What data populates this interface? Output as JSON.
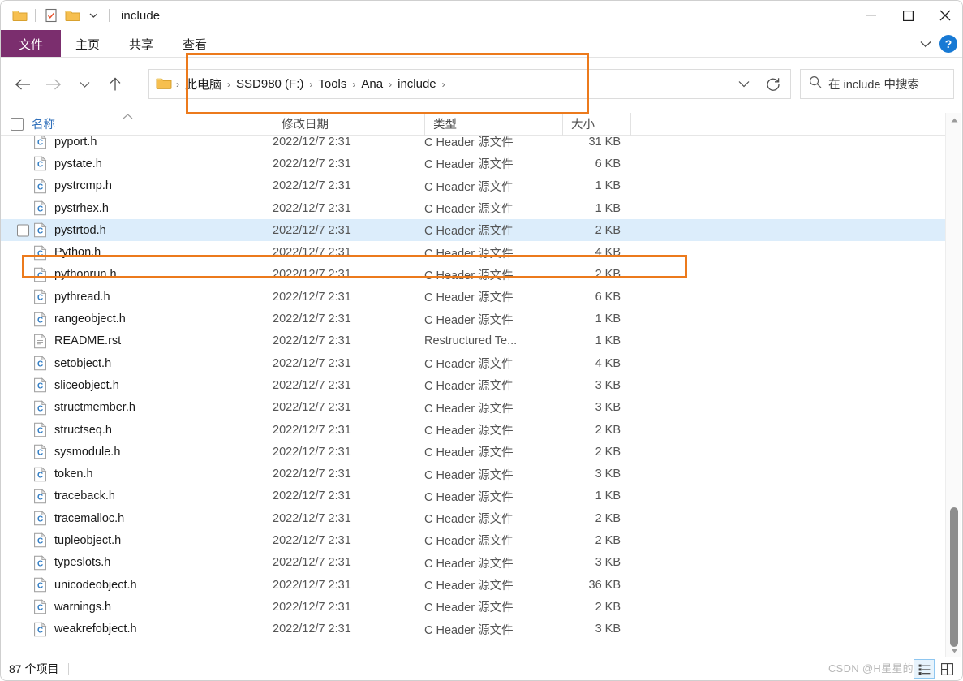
{
  "window": {
    "title": "include",
    "quick_access": [
      "folder-icon",
      "properties-icon",
      "new-folder-icon",
      "customize-chevron-icon"
    ],
    "controls": {
      "minimize": "–",
      "maximize": "□",
      "close": "✕"
    }
  },
  "ribbon": {
    "tabs": [
      {
        "label": "文件",
        "active": true,
        "accent": "#7b2e6e"
      },
      {
        "label": "主页",
        "active": false
      },
      {
        "label": "共享",
        "active": false
      },
      {
        "label": "查看",
        "active": false
      }
    ],
    "collapse_icon": "chevron-down-icon",
    "help_label": "?"
  },
  "navigation": {
    "back": "←",
    "forward": "→",
    "recent": "∨",
    "up": "↑"
  },
  "address": {
    "breadcrumbs": [
      "此电脑",
      "SSD980 (F:)",
      "Tools",
      "Ana",
      "include"
    ],
    "separator": "›",
    "trailing_separator": "›",
    "dropdown_icon": "chevron-down-icon",
    "refresh_icon": "refresh-icon"
  },
  "search": {
    "placeholder": "在 include 中搜索",
    "icon": "search-icon"
  },
  "columns": [
    {
      "key": "name",
      "label": "名称",
      "sorted": true,
      "sort_dir": "asc"
    },
    {
      "key": "date",
      "label": "修改日期",
      "sorted": false
    },
    {
      "key": "type",
      "label": "类型",
      "sorted": false
    },
    {
      "key": "size",
      "label": "大小",
      "sorted": false
    }
  ],
  "files": [
    {
      "name": "pyport.h",
      "date": "2022/12/7 2:31",
      "type": "C Header 源文件",
      "size": "31 KB",
      "icon": "c-header-icon",
      "selected": false
    },
    {
      "name": "pystate.h",
      "date": "2022/12/7 2:31",
      "type": "C Header 源文件",
      "size": "6 KB",
      "icon": "c-header-icon",
      "selected": false
    },
    {
      "name": "pystrcmp.h",
      "date": "2022/12/7 2:31",
      "type": "C Header 源文件",
      "size": "1 KB",
      "icon": "c-header-icon",
      "selected": false
    },
    {
      "name": "pystrhex.h",
      "date": "2022/12/7 2:31",
      "type": "C Header 源文件",
      "size": "1 KB",
      "icon": "c-header-icon",
      "selected": false
    },
    {
      "name": "pystrtod.h",
      "date": "2022/12/7 2:31",
      "type": "C Header 源文件",
      "size": "2 KB",
      "icon": "c-header-icon",
      "selected": true
    },
    {
      "name": "Python.h",
      "date": "2022/12/7 2:31",
      "type": "C Header 源文件",
      "size": "4 KB",
      "icon": "c-header-icon",
      "selected": false,
      "highlighted": true
    },
    {
      "name": "pythonrun.h",
      "date": "2022/12/7 2:31",
      "type": "C Header 源文件",
      "size": "2 KB",
      "icon": "c-header-icon",
      "selected": false
    },
    {
      "name": "pythread.h",
      "date": "2022/12/7 2:31",
      "type": "C Header 源文件",
      "size": "6 KB",
      "icon": "c-header-icon",
      "selected": false
    },
    {
      "name": "rangeobject.h",
      "date": "2022/12/7 2:31",
      "type": "C Header 源文件",
      "size": "1 KB",
      "icon": "c-header-icon",
      "selected": false
    },
    {
      "name": "README.rst",
      "date": "2022/12/7 2:31",
      "type": "Restructured Te...",
      "size": "1 KB",
      "icon": "text-file-icon",
      "selected": false
    },
    {
      "name": "setobject.h",
      "date": "2022/12/7 2:31",
      "type": "C Header 源文件",
      "size": "4 KB",
      "icon": "c-header-icon",
      "selected": false
    },
    {
      "name": "sliceobject.h",
      "date": "2022/12/7 2:31",
      "type": "C Header 源文件",
      "size": "3 KB",
      "icon": "c-header-icon",
      "selected": false
    },
    {
      "name": "structmember.h",
      "date": "2022/12/7 2:31",
      "type": "C Header 源文件",
      "size": "3 KB",
      "icon": "c-header-icon",
      "selected": false
    },
    {
      "name": "structseq.h",
      "date": "2022/12/7 2:31",
      "type": "C Header 源文件",
      "size": "2 KB",
      "icon": "c-header-icon",
      "selected": false
    },
    {
      "name": "sysmodule.h",
      "date": "2022/12/7 2:31",
      "type": "C Header 源文件",
      "size": "2 KB",
      "icon": "c-header-icon",
      "selected": false
    },
    {
      "name": "token.h",
      "date": "2022/12/7 2:31",
      "type": "C Header 源文件",
      "size": "3 KB",
      "icon": "c-header-icon",
      "selected": false
    },
    {
      "name": "traceback.h",
      "date": "2022/12/7 2:31",
      "type": "C Header 源文件",
      "size": "1 KB",
      "icon": "c-header-icon",
      "selected": false
    },
    {
      "name": "tracemalloc.h",
      "date": "2022/12/7 2:31",
      "type": "C Header 源文件",
      "size": "2 KB",
      "icon": "c-header-icon",
      "selected": false
    },
    {
      "name": "tupleobject.h",
      "date": "2022/12/7 2:31",
      "type": "C Header 源文件",
      "size": "2 KB",
      "icon": "c-header-icon",
      "selected": false
    },
    {
      "name": "typeslots.h",
      "date": "2022/12/7 2:31",
      "type": "C Header 源文件",
      "size": "3 KB",
      "icon": "c-header-icon",
      "selected": false
    },
    {
      "name": "unicodeobject.h",
      "date": "2022/12/7 2:31",
      "type": "C Header 源文件",
      "size": "36 KB",
      "icon": "c-header-icon",
      "selected": false
    },
    {
      "name": "warnings.h",
      "date": "2022/12/7 2:31",
      "type": "C Header 源文件",
      "size": "2 KB",
      "icon": "c-header-icon",
      "selected": false
    },
    {
      "name": "weakrefobject.h",
      "date": "2022/12/7 2:31",
      "type": "C Header 源文件",
      "size": "3 KB",
      "icon": "c-header-icon",
      "selected": false
    }
  ],
  "status": {
    "item_count": "87 个项目",
    "watermark": "CSDN @H星星的",
    "view_details_icon": "details-view-icon",
    "view_large_icon": "large-icons-view-icon"
  },
  "annotations": {
    "accent_color": "#ec7a1c",
    "path_box": "breadcrumb-path-highlight",
    "file_box": "python-h-row-highlight"
  }
}
